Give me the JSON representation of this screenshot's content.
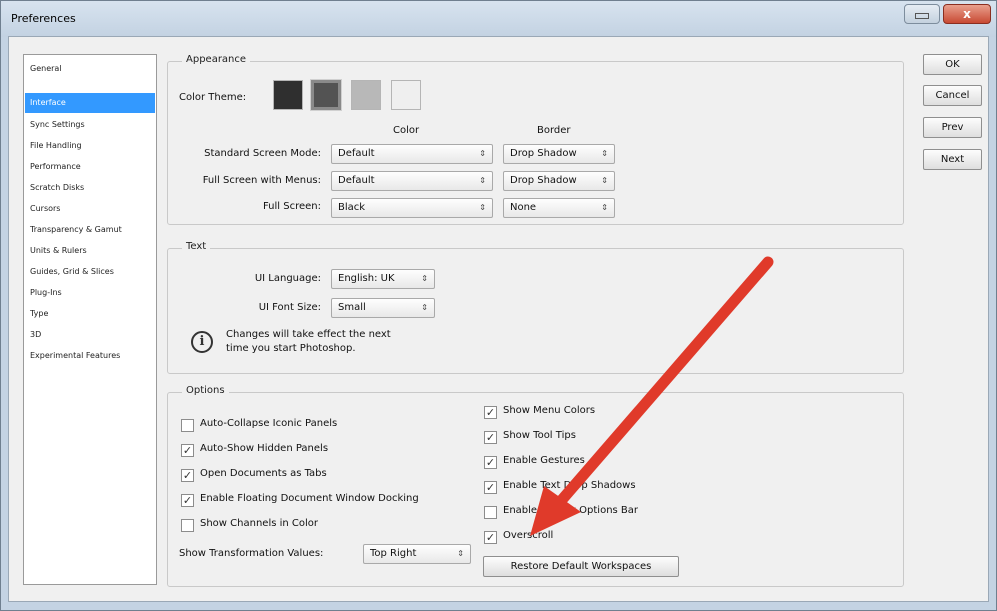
{
  "window": {
    "title": "Preferences"
  },
  "sidebar": {
    "items": [
      {
        "label": "General"
      },
      {
        "label": "Interface"
      },
      {
        "label": "Sync Settings"
      },
      {
        "label": "File Handling"
      },
      {
        "label": "Performance"
      },
      {
        "label": "Scratch Disks"
      },
      {
        "label": "Cursors"
      },
      {
        "label": "Transparency & Gamut"
      },
      {
        "label": "Units & Rulers"
      },
      {
        "label": "Guides, Grid & Slices"
      },
      {
        "label": "Plug-Ins"
      },
      {
        "label": "Type"
      },
      {
        "label": "3D"
      },
      {
        "label": "Experimental Features"
      }
    ],
    "selected": "Interface"
  },
  "appearance": {
    "legend": "Appearance",
    "color_theme_label": "Color Theme:",
    "theme_swatches": [
      {
        "color": "#2f2f2f",
        "selected": false
      },
      {
        "color": "#535353",
        "selected": true
      },
      {
        "color": "#b8b8b8",
        "selected": false
      },
      {
        "color": "#efefef",
        "selected": false
      }
    ],
    "color_header": "Color",
    "border_header": "Border",
    "rows": [
      {
        "label": "Standard Screen Mode:",
        "color": "Default",
        "border": "Drop Shadow"
      },
      {
        "label": "Full Screen with Menus:",
        "color": "Default",
        "border": "Drop Shadow"
      },
      {
        "label": "Full Screen:",
        "color": "Black",
        "border": "None"
      }
    ]
  },
  "text": {
    "legend": "Text",
    "ui_language_label": "UI Language:",
    "ui_language_value": "English: UK",
    "ui_font_size_label": "UI Font Size:",
    "ui_font_size_value": "Small",
    "info_line1": "Changes will take effect the next",
    "info_line2": "time you start Photoshop."
  },
  "options": {
    "legend": "Options",
    "left_checkboxes": [
      {
        "label": "Auto-Collapse Iconic Panels",
        "checked": false
      },
      {
        "label": "Auto-Show Hidden Panels",
        "checked": true
      },
      {
        "label": "Open Documents as Tabs",
        "checked": true
      },
      {
        "label": "Enable Floating Document Window Docking",
        "checked": true
      },
      {
        "label": "Show Channels in Color",
        "checked": false
      }
    ],
    "right_checkboxes": [
      {
        "label": "Show Menu Colors",
        "checked": true
      },
      {
        "label": "Show Tool Tips",
        "checked": true
      },
      {
        "label": "Enable Gestures",
        "checked": true
      },
      {
        "label": "Enable Text Drop Shadows",
        "checked": true
      },
      {
        "label": "Enable Narrow Options Bar",
        "checked": false
      },
      {
        "label": "Overscroll",
        "checked": true
      }
    ],
    "show_transformation_label": "Show Transformation Values:",
    "show_transformation_value": "Top Right",
    "restore_button": "Restore Default Workspaces"
  },
  "buttons": {
    "ok": "OK",
    "cancel": "Cancel",
    "prev": "Prev",
    "next": "Next"
  },
  "annotation": {
    "arrow_color": "#e03a2a"
  },
  "title_buttons": {
    "close_glyph": "x"
  },
  "glyphs": {
    "dropdown": "⇕",
    "check": "✓",
    "info": "i"
  }
}
